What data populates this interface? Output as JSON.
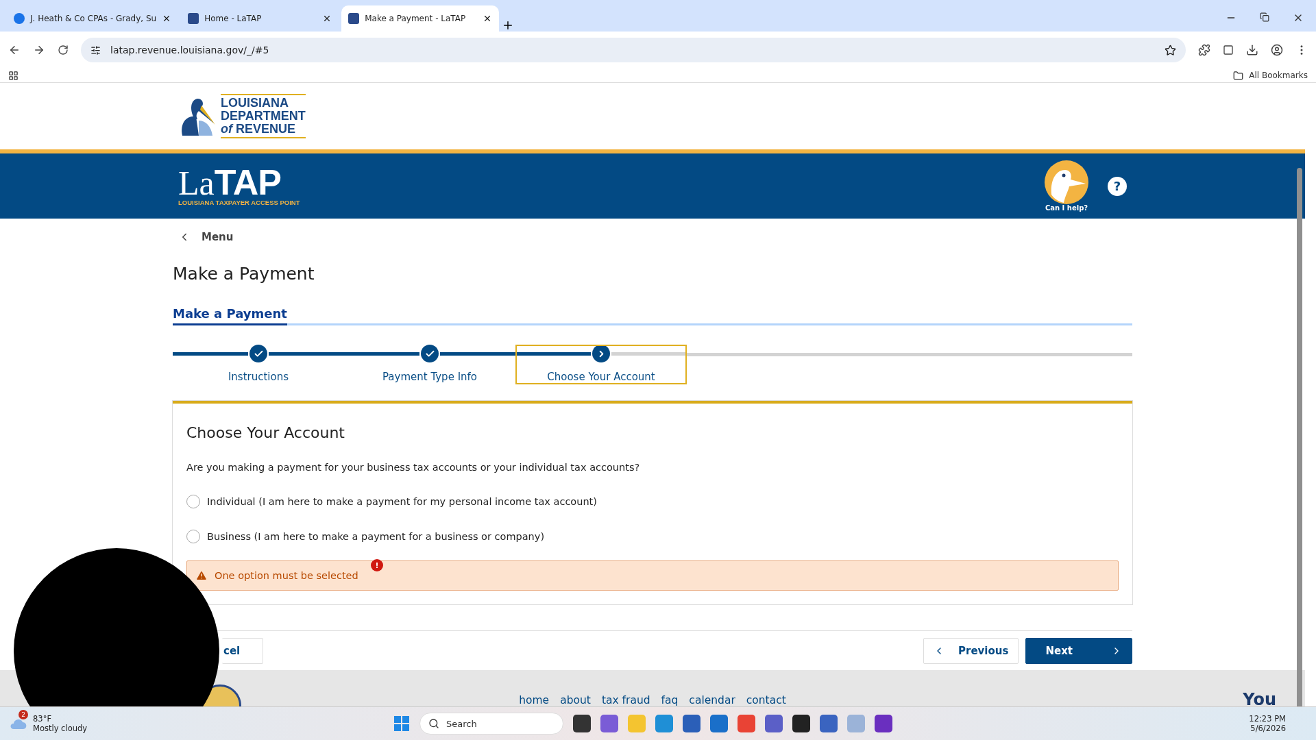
{
  "browser": {
    "tabs": [
      {
        "title": "J. Heath & Co CPAs - Grady, Su",
        "selected": false
      },
      {
        "title": "Home - LaTAP",
        "selected": false
      },
      {
        "title": "Make a Payment - LaTAP",
        "selected": true
      }
    ],
    "url": "latap.revenue.louisiana.gov/_/#5",
    "bookmarks": "All Bookmarks"
  },
  "agency_logo": {
    "lines": [
      "LOUISIANA",
      "DEPARTMENT",
      "*of* REVENUE"
    ]
  },
  "banner": {
    "logo_main": "La",
    "logo_bold": "TAP",
    "logo_sub": "LOUISIANA TAXPAYER ACCESS POINT",
    "assistant": "Can I help?",
    "help": "?"
  },
  "nav": {
    "menu": "Menu"
  },
  "page_title": "Make a Payment",
  "subtabs": [
    {
      "label": "Make a Payment",
      "selected": true
    }
  ],
  "steps": [
    {
      "label": "Instructions",
      "kind": "complete"
    },
    {
      "label": "Payment Type Info",
      "kind": "complete"
    },
    {
      "label": "Choose Your Account",
      "kind": "current"
    }
  ],
  "card": {
    "title": "Choose Your Account",
    "question": "Are you making a payment for your business tax accounts or your individual tax accounts?",
    "options": [
      {
        "label": "Individual (I am here to make a payment for my personal income tax account)",
        "selected": false
      },
      {
        "label": "Business (I am here to make a payment for a business or company)",
        "selected": false
      }
    ],
    "error": "One option must be selected",
    "error_badge": "!"
  },
  "buttons": {
    "cancel": "cel",
    "previous": "Previous",
    "next": "Next"
  },
  "footer": {
    "links": [
      "home",
      "about",
      "tax fraud",
      "faq",
      "calendar",
      "contact"
    ],
    "partial": "You"
  },
  "taskbar": {
    "badge": "2",
    "temperature": "83°F",
    "weather": "Mostly cloudy",
    "search": "Search",
    "time": "12:23 PM",
    "date": "5/6/2026"
  }
}
